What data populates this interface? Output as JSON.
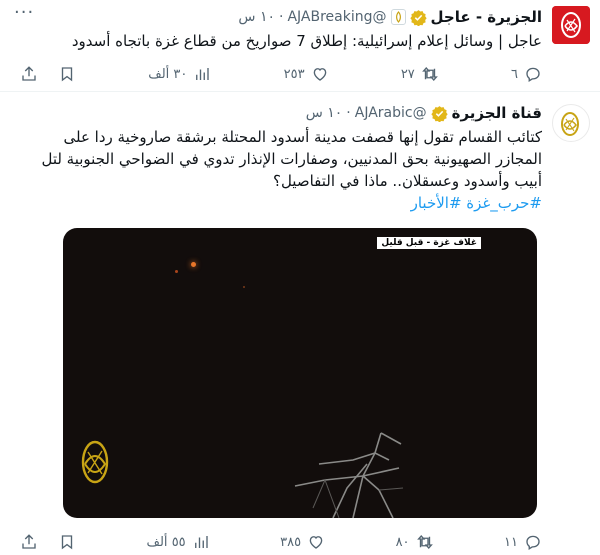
{
  "tweets": [
    {
      "name": "الجزيرة - عاجل",
      "handle": "@AJABreaking",
      "dot": "·",
      "time": "١٠ س",
      "text": "عاجل | وسائل إعلام إسرائيلية: إطلاق 7 صواريخ من قطاع غزة باتجاه أسدود",
      "stats": {
        "replies": "٦",
        "retweets": "٢٧",
        "likes": "٢٥٣",
        "views": "٣٠ ألف"
      }
    },
    {
      "name": "قناة الجزيرة",
      "handle": "@AJArabic",
      "dot": "·",
      "time": "١٠ س",
      "text": "كتائب القسام تقول إنها قصفت مدينة أسدود المحتلة برشقة صاروخية ردا على المجازر الصهيونية بحق المدنيين، وصفارات الإنذار تدوي في الضواحي الجنوبية لتل أبيب وأسدود وعسقلان.. ماذا في التفاصيل؟",
      "hashtags": "#حرب_غزة #الأخبار",
      "media_label": "غلاف غزة - قبل قليل",
      "stats": {
        "replies": "١١",
        "retweets": "٨٠",
        "likes": "٣٨٥",
        "views": "٥٥ ألف"
      }
    }
  ],
  "colors": {
    "verified": "#e2b719",
    "accent": "#1d9bf0",
    "muted": "#536471",
    "breaking_red": "#d71920"
  },
  "icons": [
    "aljazeera-logo-icon",
    "verified-badge-icon",
    "more-icon",
    "reply-icon",
    "retweet-icon",
    "like-icon",
    "views-icon",
    "bookmark-icon",
    "share-icon"
  ]
}
